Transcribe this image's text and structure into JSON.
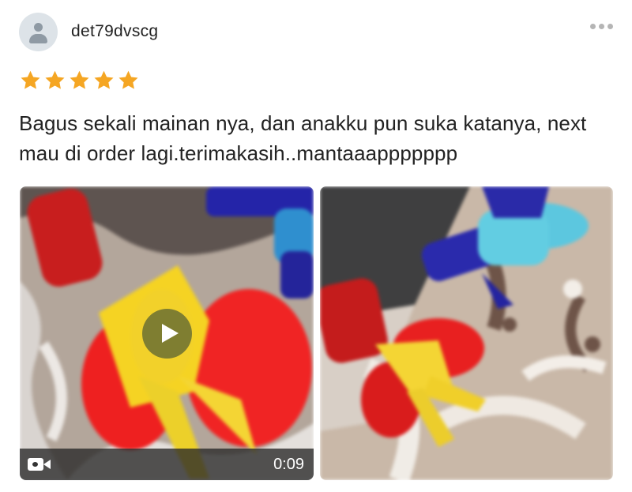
{
  "user": {
    "name": "det79dvscg",
    "avatar_icon": "user-silhouette-icon"
  },
  "rating": {
    "value": 5,
    "max": 5,
    "star_color": "#f5a623"
  },
  "review": {
    "text": "Bagus sekali mainan nya, dan anakku pun suka katanya, next mau di order lagi.terimakasih..mantaaappppppp"
  },
  "media": [
    {
      "type": "video",
      "duration": "0:09",
      "icon": "video-camera-icon"
    },
    {
      "type": "image"
    }
  ],
  "colors": {
    "accent_play": "#6b7032",
    "text": "#222222"
  }
}
